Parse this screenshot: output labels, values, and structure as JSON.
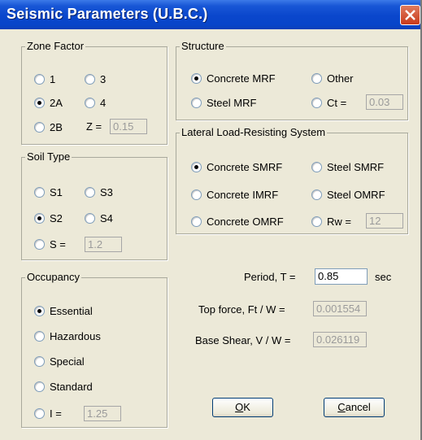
{
  "window": {
    "title": "Seismic Parameters (U.B.C.)",
    "close_glyph": "X"
  },
  "zone_factor": {
    "legend": "Zone Factor",
    "options": [
      {
        "label": "1",
        "checked": false
      },
      {
        "label": "3",
        "checked": false
      },
      {
        "label": "2A",
        "checked": true
      },
      {
        "label": "4",
        "checked": false
      },
      {
        "label": "2B",
        "checked": false
      }
    ],
    "z_label": "Z =",
    "z_value": "0.15"
  },
  "soil_type": {
    "legend": "Soil Type",
    "options": [
      {
        "label": "S1",
        "checked": false
      },
      {
        "label": "S3",
        "checked": false
      },
      {
        "label": "S2",
        "checked": true
      },
      {
        "label": "S4",
        "checked": false
      },
      {
        "label": "S =",
        "checked": false
      }
    ],
    "s_value": "1.2"
  },
  "occupancy": {
    "legend": "Occupancy",
    "options": [
      {
        "label": "Essential",
        "checked": true
      },
      {
        "label": "Hazardous",
        "checked": false
      },
      {
        "label": "Special",
        "checked": false
      },
      {
        "label": "Standard",
        "checked": false
      },
      {
        "label": "I =",
        "checked": false
      }
    ],
    "i_value": "1.25"
  },
  "structure": {
    "legend": "Structure",
    "options": [
      {
        "label": "Concrete MRF",
        "checked": true
      },
      {
        "label": "Other",
        "checked": false
      },
      {
        "label": "Steel MRF",
        "checked": false
      },
      {
        "label": "Ct =",
        "checked": false
      }
    ],
    "ct_value": "0.03"
  },
  "lateral": {
    "legend": "Lateral Load-Resisting System",
    "options": [
      {
        "label": "Concrete SMRF",
        "checked": true
      },
      {
        "label": "Steel SMRF",
        "checked": false
      },
      {
        "label": "Concrete IMRF",
        "checked": false
      },
      {
        "label": "Steel OMRF",
        "checked": false
      },
      {
        "label": "Concrete OMRF",
        "checked": false
      },
      {
        "label": "Rw =",
        "checked": false
      }
    ],
    "rw_value": "12"
  },
  "results": {
    "period_label": "Period, T =",
    "period_value": "0.85",
    "period_unit": "sec",
    "topforce_label": "Top force, Ft / W =",
    "topforce_value": "0.001554",
    "baseshear_label": "Base Shear, V / W =",
    "baseshear_value": "0.026119"
  },
  "buttons": {
    "ok_mnemonic": "O",
    "ok_rest": "K",
    "cancel_mnemonic": "C",
    "cancel_rest": "ancel"
  },
  "colors": {
    "title_bar": "#0a46cc",
    "dialog_bg": "#ece9d8",
    "close_button": "#c8391a"
  }
}
